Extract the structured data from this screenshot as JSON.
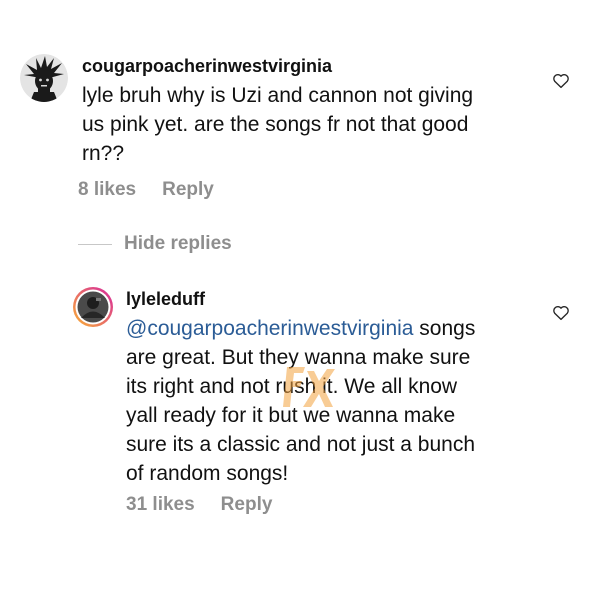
{
  "comment": {
    "username": "cougarpoacherinwestvirginia",
    "lines": [
      "lyle bruh why is Uzi and cannon not giving",
      "us pink yet. are the songs fr not that good",
      "rn??"
    ],
    "likes": "8 likes",
    "reply_label": "Reply",
    "avatar_icon": "spiky-hair-avatar-icon",
    "like_icon": "heart-icon"
  },
  "thread": {
    "hide_replies_label": "Hide replies"
  },
  "reply": {
    "username": "lyleleduff",
    "mention": "@cougarpoacherinwestvirginia",
    "line1_rest": " songs",
    "lines": [
      "are great. But they wanna make sure",
      "its right and not rush it. We all know",
      "yall ready for it but we wanna make",
      "sure its a classic and not just a bunch",
      "of random songs!"
    ],
    "likes": "31 likes",
    "reply_label": "Reply",
    "avatar_icon": "story-ring-avatar-icon",
    "like_icon": "heart-icon"
  },
  "colors": {
    "text": "#111111",
    "meta": "#8e8e8e",
    "mention": "#2b5c96",
    "story_ring_start": "#f9b233",
    "story_ring_end": "#d6249f",
    "watermark": "#f4a340"
  },
  "watermark_icon": "fx-watermark-icon"
}
